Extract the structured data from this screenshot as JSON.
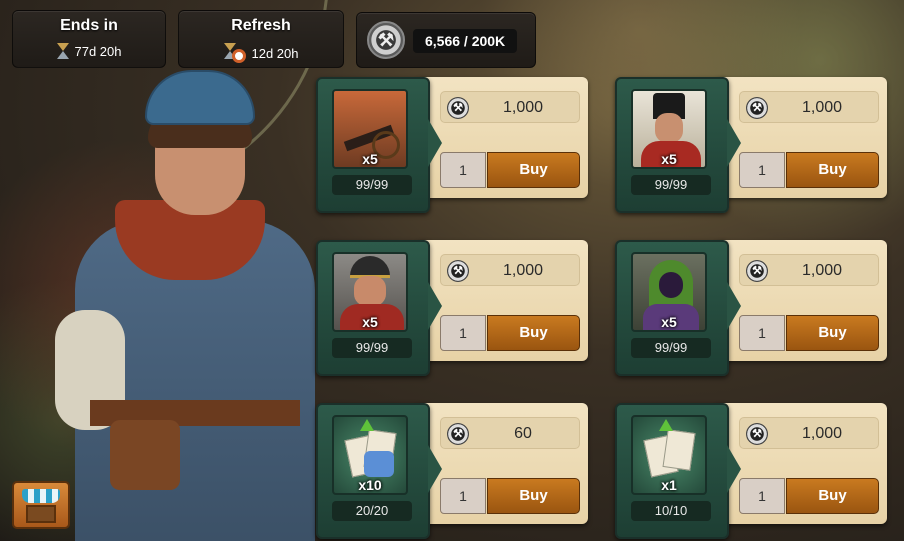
{
  "header": {
    "ends_in": {
      "title": "Ends in",
      "value": "77d 20h"
    },
    "refresh": {
      "title": "Refresh",
      "value": "12d 20h"
    },
    "currency": {
      "value": "6,566 / 200K",
      "icon": "coin-icon"
    }
  },
  "items": [
    {
      "name": "artillery",
      "qty": "x5",
      "stock": "99/99",
      "price": "1,000",
      "count": "1",
      "buy_label": "Buy",
      "icon": "artillery-unit-icon"
    },
    {
      "name": "soldier",
      "qty": "x5",
      "stock": "99/99",
      "price": "1,000",
      "count": "1",
      "buy_label": "Buy",
      "icon": "soldier-unit-icon"
    },
    {
      "name": "officer",
      "qty": "x5",
      "stock": "99/99",
      "price": "1,000",
      "count": "1",
      "buy_label": "Buy",
      "icon": "officer-unit-icon"
    },
    {
      "name": "rogue",
      "qty": "x5",
      "stock": "99/99",
      "price": "1,000",
      "count": "1",
      "buy_label": "Buy",
      "icon": "rogue-unit-icon"
    },
    {
      "name": "fragments",
      "qty": "x10",
      "stock": "20/20",
      "price": "60",
      "count": "1",
      "buy_label": "Buy",
      "icon": "fragment-cards-icon"
    },
    {
      "name": "upgrade-cards",
      "qty": "x1",
      "stock": "10/10",
      "price": "1,000",
      "count": "1",
      "buy_label": "Buy",
      "icon": "upgrade-cards-icon"
    }
  ],
  "colors": {
    "buy": "#b56a18",
    "panel": "#2d5a4a",
    "plate": "#eedcb6"
  }
}
